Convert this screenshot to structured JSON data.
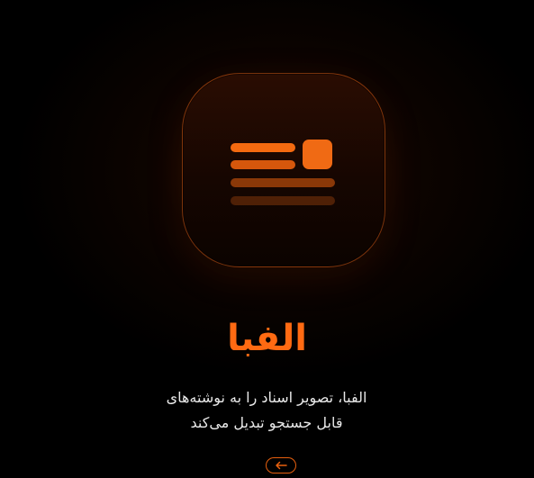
{
  "app": {
    "title": "الفبا",
    "description_line_1": "الفبا، تصویر اسناد را به نوشته‌های",
    "description_line_2": "قابل جستجو تبدیل می‌کند"
  },
  "icons": {
    "app_icon": "document-text-icon",
    "next_button_icon": "arrow-left-icon"
  },
  "colors": {
    "accent": "#ff6a12",
    "background": "#000000",
    "text": "#e9e9e9"
  }
}
